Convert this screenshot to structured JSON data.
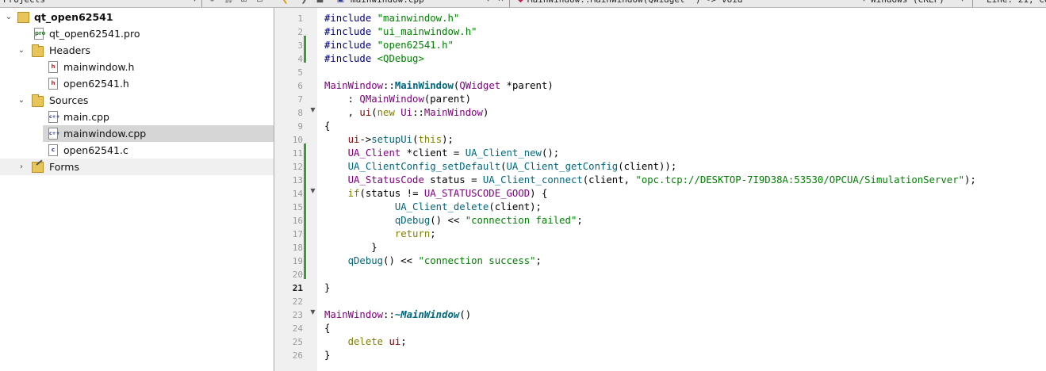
{
  "toolbar": {
    "projects_label": "Projects",
    "file_tab": "mainwindow.cpp",
    "function_combo": "MainWindow::MainWindow(QWidget *) -> void",
    "line_ending": "Windows (CRLF)",
    "cursor_position": "Line: 21, Co"
  },
  "project_tree": {
    "project_name": "qt_open62541",
    "pro_file": "qt_open62541.pro",
    "headers_label": "Headers",
    "headers": [
      "mainwindow.h",
      "open62541.h"
    ],
    "sources_label": "Sources",
    "sources": [
      "main.cpp",
      "mainwindow.cpp",
      "open62541.c"
    ],
    "forms_label": "Forms",
    "selected_file": "mainwindow.cpp",
    "icon_text": {
      "header": "h",
      "cpp": "c++",
      "c": "c",
      "pro": "pro"
    }
  },
  "editor": {
    "current_line": "21",
    "line_numbers": [
      "1",
      "2",
      "3",
      "4",
      "5",
      "6",
      "7",
      "8",
      "9",
      "10",
      "11",
      "12",
      "13",
      "14",
      "15",
      "16",
      "17",
      "18",
      "19",
      "20",
      "21",
      "22",
      "23",
      "24",
      "25",
      "26"
    ],
    "lines": [
      "#include \"mainwindow.h\"",
      "#include \"ui_mainwindow.h\"",
      "#include \"open62541.h\"",
      "#include <QDebug>",
      "",
      "MainWindow::MainWindow(QWidget *parent)",
      "    : QMainWindow(parent)",
      "    , ui(new Ui::MainWindow)",
      "{",
      "    ui->setupUi(this);",
      "    UA_Client *client = UA_Client_new();",
      "    UA_ClientConfig_setDefault(UA_Client_getConfig(client));",
      "    UA_StatusCode status = UA_Client_connect(client, \"opc.tcp://DESKTOP-7I9D38A:53530/OPCUA/SimulationServer\");",
      "    if(status != UA_STATUSCODE_GOOD) {",
      "            UA_Client_delete(client);",
      "            qDebug() << \"connection failed\";",
      "            return;",
      "        }",
      "    qDebug() << \"connection success\";",
      "",
      "}",
      "",
      "MainWindow::~MainWindow()",
      "{",
      "    delete ui;",
      "}"
    ]
  },
  "colors": {
    "keyword": "#808000",
    "string": "#008000",
    "type": "#800080",
    "function": "#00677c",
    "changebar": "#3c9a3c",
    "selection": "#d6d6d6"
  }
}
